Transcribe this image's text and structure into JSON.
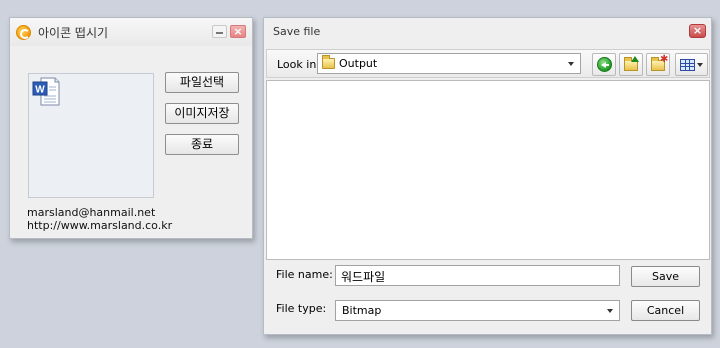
{
  "icon_window": {
    "title": "아이콘 떱시기",
    "buttons": {
      "select_file": "파일선택",
      "save_image": "이미지저장",
      "exit": "종료"
    },
    "email": "marsland@hanmail.net",
    "website": "http://www.marsland.co.kr",
    "preview_icon": "word-document-icon"
  },
  "save_dialog": {
    "title": "Save file",
    "look_in_label": "Look in:",
    "look_in_value": "Output",
    "file_name_label": "File name:",
    "file_name_value": "워드파일",
    "file_type_label": "File type:",
    "file_type_value": "Bitmap",
    "save_label": "Save",
    "cancel_label": "Cancel"
  },
  "colors": {
    "desktop": "#cdd2dc",
    "window_bg": "#efefef",
    "close_red": "#c94c4c",
    "accent_green": "#1d9a21",
    "folder_yellow": "#e8c24b"
  }
}
